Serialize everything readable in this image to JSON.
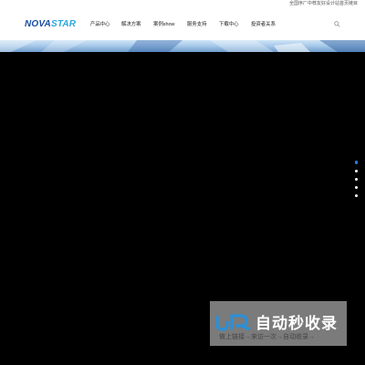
{
  "topbar": {
    "link": "全国序厂中荐友好设计站首页链目"
  },
  "brand": {
    "logo_nova": "NOVA",
    "logo_star": "STAR"
  },
  "nav": [
    {
      "label": "产品中心"
    },
    {
      "label": "解决方案"
    },
    {
      "label": "案例show"
    },
    {
      "label": "服务支持"
    },
    {
      "label": "下载中心"
    },
    {
      "label": "投资者关系"
    }
  ],
  "search": {
    "icon": "search-icon"
  },
  "carousel": {
    "total_slides": 5,
    "active_index": 0
  },
  "watermark": {
    "title": "自动秒收录",
    "subtitle": "做上链接→来访一次→自动收录→"
  },
  "colors": {
    "brand_blue": "#1a4fa0",
    "accent": "#28a8e0",
    "active_dot": "#2a7de1"
  }
}
